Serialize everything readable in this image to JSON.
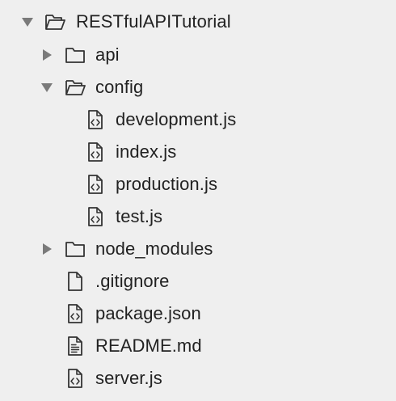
{
  "tree": {
    "root": {
      "label": "RESTfulAPITutorial",
      "icon": "folder-open-icon",
      "expanded": true
    },
    "items": [
      {
        "label": "api",
        "icon": "folder-icon",
        "expanded": false
      },
      {
        "label": "config",
        "icon": "folder-open-icon",
        "expanded": true
      },
      {
        "label": "development.js",
        "icon": "code-file-icon"
      },
      {
        "label": "index.js",
        "icon": "code-file-icon"
      },
      {
        "label": "production.js",
        "icon": "code-file-icon"
      },
      {
        "label": "test.js",
        "icon": "code-file-icon"
      },
      {
        "label": "node_modules",
        "icon": "folder-icon",
        "expanded": false
      },
      {
        "label": ".gitignore",
        "icon": "file-icon"
      },
      {
        "label": "package.json",
        "icon": "code-file-icon"
      },
      {
        "label": "README.md",
        "icon": "text-file-icon"
      },
      {
        "label": "server.js",
        "icon": "code-file-icon"
      }
    ]
  },
  "colors": {
    "background": "#efefef",
    "text": "#222222",
    "icon": "#333333",
    "arrow": "#7a7a7a"
  }
}
